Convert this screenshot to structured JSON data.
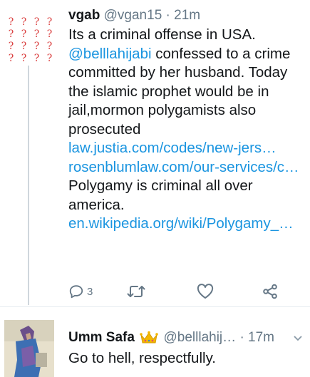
{
  "tweet1": {
    "name": "vgab",
    "handle": "@vgan15",
    "separator": "·",
    "time": "21m",
    "text_1": "Its a criminal offense in USA.",
    "mention": "@belllahijabi",
    "text_2": " confessed to a crime committed by her husband. Today the islamic prophet would be in jail,mormon polygamists also prosecuted ",
    "link_1": "law.justia.com/codes/new-jers…",
    "link_2": "rosenblumlaw.com/our-services/c…",
    "text_3": "Polygamy is criminal all over america.",
    "link_3": "en.wikipedia.org/wiki/Polygamy_…",
    "avatar_glyph": "?",
    "reply_count": "3"
  },
  "tweet2": {
    "name": "Umm Safa",
    "handle": "@belllahij…",
    "separator": "·",
    "time": "17m",
    "text": "Go to hell, respectfully."
  },
  "icons": {
    "reply": "reply-icon",
    "retweet": "retweet-icon",
    "like": "heart-icon",
    "share": "share-icon",
    "crown": "crown-emoji-icon",
    "caret": "chevron-down-icon"
  },
  "colors": {
    "link": "#1b95e0",
    "muted": "#657786",
    "text": "#14171a",
    "avatar_glyph": "#d93a3a"
  }
}
